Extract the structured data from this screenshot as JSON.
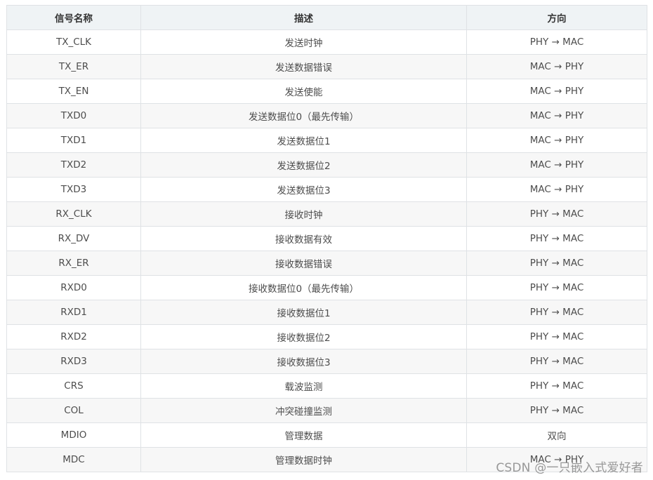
{
  "table": {
    "headers": [
      "信号名称",
      "描述",
      "方向"
    ],
    "rows": [
      [
        "TX_CLK",
        "发送时钟",
        "PHY → MAC"
      ],
      [
        "TX_ER",
        "发送数据错误",
        "MAC → PHY"
      ],
      [
        "TX_EN",
        "发送使能",
        "MAC → PHY"
      ],
      [
        "TXD0",
        "发送数据位0（最先传输）",
        "MAC → PHY"
      ],
      [
        "TXD1",
        "发送数据位1",
        "MAC → PHY"
      ],
      [
        "TXD2",
        "发送数据位2",
        "MAC → PHY"
      ],
      [
        "TXD3",
        "发送数据位3",
        "MAC → PHY"
      ],
      [
        "RX_CLK",
        "接收时钟",
        "PHY → MAC"
      ],
      [
        "RX_DV",
        "接收数据有效",
        "PHY → MAC"
      ],
      [
        "RX_ER",
        "接收数据错误",
        "PHY → MAC"
      ],
      [
        "RXD0",
        "接收数据位0（最先传输）",
        "PHY → MAC"
      ],
      [
        "RXD1",
        "接收数据位1",
        "PHY → MAC"
      ],
      [
        "RXD2",
        "接收数据位2",
        "PHY → MAC"
      ],
      [
        "RXD3",
        "接收数据位3",
        "PHY → MAC"
      ],
      [
        "CRS",
        "载波监测",
        "PHY → MAC"
      ],
      [
        "COL",
        "冲突碰撞监测",
        "PHY → MAC"
      ],
      [
        "MDIO",
        "管理数据",
        "双向"
      ],
      [
        "MDC",
        "管理数据时钟",
        "MAC → PHY"
      ]
    ]
  },
  "watermark": "CSDN @一只嵌入式爱好者",
  "colors": {
    "header_bg": "#eff3f5",
    "row_alt_bg": "#f7f7f7",
    "border": "#dfe2e5",
    "text": "#4d4d4d"
  }
}
